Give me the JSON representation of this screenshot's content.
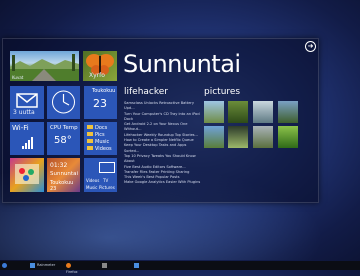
{
  "screen": {
    "title": "Sunnuntai"
  },
  "tiles": {
    "landscape_label": "Kuvat",
    "butterfly_label": "Xyrfo",
    "day_name": "Toukokuu",
    "day_number": "23",
    "mail_count": "3 uutta",
    "mail_label": "Sähköposti",
    "clock_label": "Kello",
    "wifi_title": "Wi-Fi",
    "wifi_label": "Yhteys",
    "cpu_title": "CPU Temp",
    "cpu_value": "58°",
    "folders": [
      "Docs",
      "Pics",
      "Music",
      "Videos"
    ],
    "app_label": "Paint",
    "calendar_time": "01:32",
    "calendar_day": "Sunnuntai",
    "calendar_date": "Toukokuu 23",
    "videos_label": "Videos",
    "tv_label": "TV",
    "music_label": "Music",
    "pictures_label": "Pictures"
  },
  "lifehacker": {
    "heading": "lifehacker",
    "lines": [
      "Samsclass Unlocks Retroactive Battery Upd...",
      "Turn Your Computer's CD Tray into an iPod Dock",
      "Get Android 2.2 on Your Nexus One Without...",
      "Lifehacker Weekly Roundup Top Stories...",
      "How to Create a Simpler Netflix Queue",
      "Keep Your Desktop Tasks and Apps Sorted...",
      "Top 10 Privacy Tweaks You Should Know About",
      "Five Best Audio Editors Software...",
      "Transfer Files Faster Printing Sharing",
      "This Week's Best Popular Posts",
      "Make Google Analytics Easier With Plugins"
    ]
  },
  "pictures": {
    "heading": "pictures"
  },
  "taskbar": {
    "items": [
      "start",
      "Rainmeter",
      "",
      "Firefox",
      "",
      "Rainmeter",
      "rainmeter.png"
    ]
  }
}
